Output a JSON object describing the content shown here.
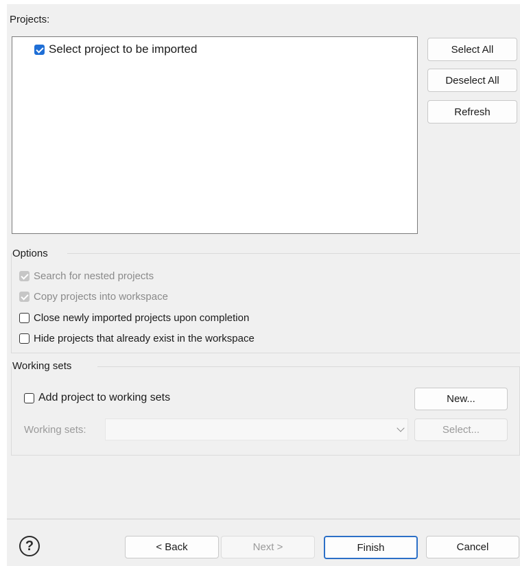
{
  "projects": {
    "label": "Projects:",
    "items": [
      {
        "label": "Select project to be imported",
        "checked": true
      }
    ],
    "buttons": {
      "select_all": "Select All",
      "deselect_all": "Deselect All",
      "refresh": "Refresh"
    }
  },
  "options": {
    "legend": "Options",
    "items": [
      {
        "label": "Search for nested projects",
        "checked": true,
        "enabled": false
      },
      {
        "label": "Copy projects into workspace",
        "checked": true,
        "enabled": false
      },
      {
        "label": "Close newly imported projects upon completion",
        "checked": false,
        "enabled": true
      },
      {
        "label": "Hide projects that already exist in the workspace",
        "checked": false,
        "enabled": true
      }
    ]
  },
  "working_sets": {
    "legend": "Working sets",
    "add_label": "Add project to working sets",
    "new_button": "New...",
    "sets_label": "Working sets:",
    "sets_value": "",
    "select_button": "Select..."
  },
  "footer": {
    "help": "?",
    "back": "< Back",
    "next": "Next >",
    "finish": "Finish",
    "cancel": "Cancel"
  },
  "icons": {
    "help": "help-icon",
    "checkbox": "checkbox-icon",
    "dropdown": "chevron-down-icon"
  },
  "colors": {
    "accent": "#1f6fd6",
    "dialog_bg": "#f0f0f0",
    "default_button_border": "#2b6fc7"
  }
}
